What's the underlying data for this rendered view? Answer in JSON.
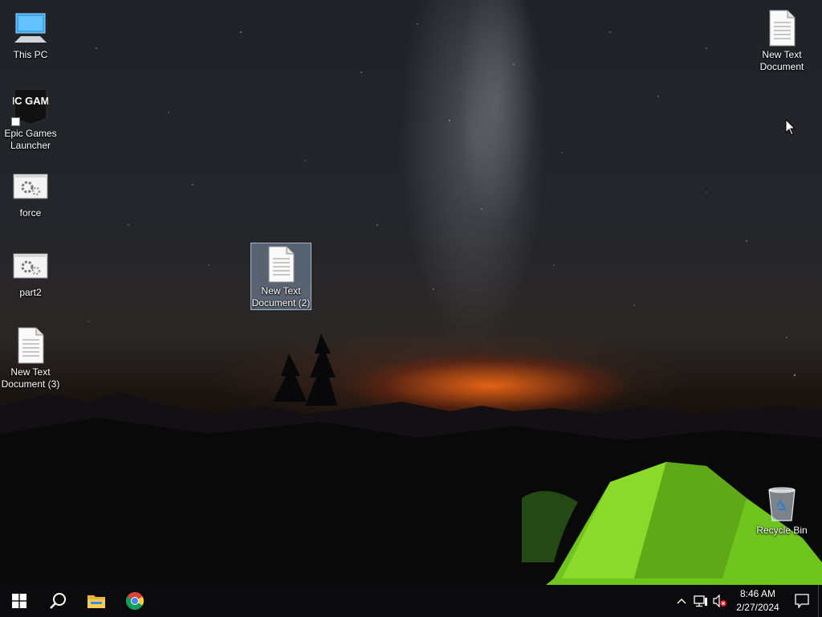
{
  "desktop": {
    "icons": [
      {
        "label": "This PC",
        "icon": "this-pc-icon"
      },
      {
        "label": "Epic Games Launcher",
        "icon": "epic-games-icon",
        "logo_text": "EPIC GAMES"
      },
      {
        "label": "force",
        "icon": "batch-file-icon"
      },
      {
        "label": "part2",
        "icon": "batch-file-icon"
      },
      {
        "label": "New Text Document (3)",
        "icon": "text-document-icon"
      },
      {
        "label": "New Text Document (2)",
        "icon": "text-document-icon",
        "selected": true
      },
      {
        "label": "New Text Document",
        "icon": "text-document-icon"
      },
      {
        "label": "Recycle Bin",
        "icon": "recycle-bin-icon"
      }
    ]
  },
  "taskbar": {
    "pinned": [
      {
        "name": "Start",
        "icon": "windows-logo-icon"
      },
      {
        "name": "Search",
        "icon": "search-icon"
      },
      {
        "name": "File Explorer",
        "icon": "folder-icon"
      },
      {
        "name": "Google Chrome",
        "icon": "chrome-icon"
      }
    ],
    "tray": {
      "icons": [
        "chevron-up-icon",
        "network-icon",
        "volume-muted-icon"
      ],
      "time": "8:46 AM",
      "date": "2/27/2024"
    }
  }
}
